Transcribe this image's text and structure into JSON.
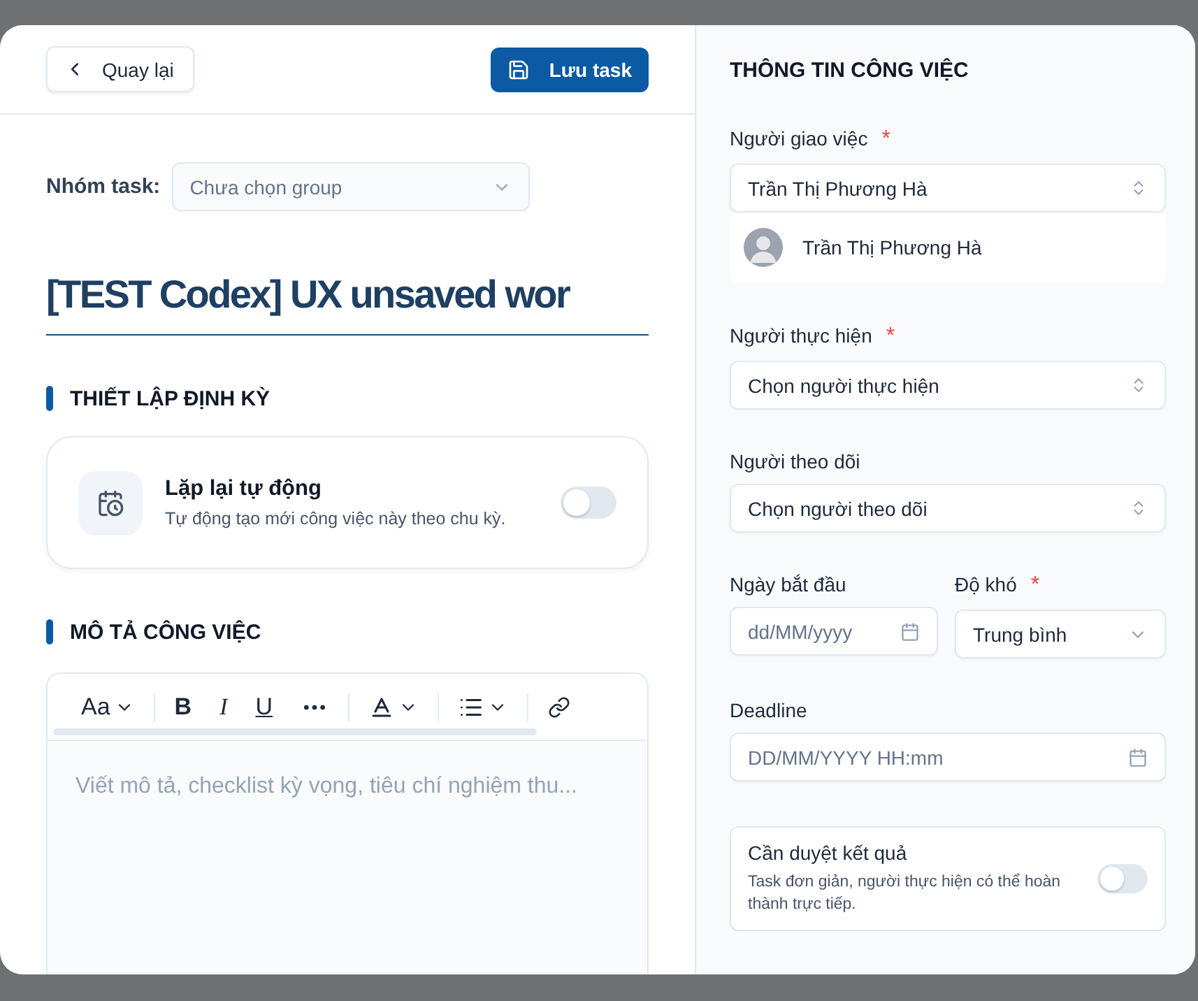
{
  "header": {
    "back_button": "Quay lại",
    "save_button": "Lưu task"
  },
  "group": {
    "label": "Nhóm task:",
    "placeholder": "Chưa chọn group"
  },
  "title": "[TEST Codex] UX unsaved wor",
  "recurring": {
    "heading": "THIẾT LẬP ĐỊNH KỲ",
    "title": "Lặp lại tự động",
    "description": "Tự động tạo mới công việc này theo chu kỳ.",
    "on": false
  },
  "description": {
    "heading": "MÔ TẢ CÔNG VIỆC",
    "toolbar": {
      "font": "Aa",
      "bold": "B",
      "italic": "I",
      "underline": "U"
    },
    "placeholder": "Viết mô tả, checklist kỳ vọng, tiêu chí nghiệm thu..."
  },
  "info": {
    "heading": "THÔNG TIN CÔNG VIỆC",
    "assigner": {
      "label": "Người giao việc",
      "required_mark": "*",
      "value": "Trần Thị Phương Hà",
      "chip": "Trần Thị Phương Hà"
    },
    "assignee": {
      "label": "Người thực hiện",
      "required_mark": "*",
      "placeholder": "Chọn người thực hiện"
    },
    "watcher": {
      "label": "Người theo dõi",
      "placeholder": "Chọn người theo dõi"
    },
    "start_date": {
      "label": "Ngày bắt đầu",
      "placeholder": "dd/MM/yyyy"
    },
    "difficulty": {
      "label": "Độ khó",
      "required_mark": "*",
      "value": "Trung bình"
    },
    "deadline": {
      "label": "Deadline",
      "placeholder": "DD/MM/YYYY HH:mm"
    },
    "review": {
      "title": "Cần duyệt kết quả",
      "description": "Task đơn giản, người thực hiện có thể hoàn thành trực tiếp.",
      "on": false
    }
  }
}
